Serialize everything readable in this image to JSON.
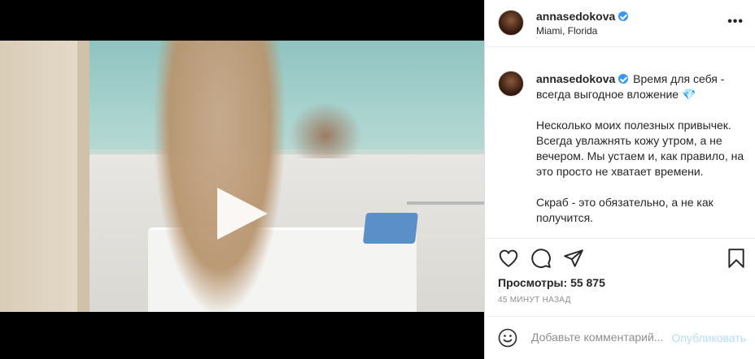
{
  "post": {
    "username": "annasedokova",
    "location": "Miami, Florida",
    "caption_title": "Время для себя - всегда выгодное вложение 💎",
    "caption_paragraphs": [
      "Несколько моих полезных привычек. Всегда увлажнять кожу утром, а не вечером. Мы устаем и, как правило, на это просто не хватает времени.",
      "Скраб - это обязательно, а не как получится."
    ],
    "views_label": "Просмотры:",
    "views_count": "55 875",
    "timestamp": "45 МИНУТ НАЗАД"
  },
  "comment": {
    "placeholder": "Добавьте комментарий...",
    "post_label": "Опубликовать"
  },
  "colors": {
    "verified": "#3897f0",
    "post_button": "#b2dffc",
    "text": "#262626",
    "muted": "#8e8e8e"
  },
  "icons": [
    "user-icon",
    "sound-icon",
    "play-icon",
    "more-icon",
    "heart-icon",
    "comment-icon",
    "share-icon",
    "bookmark-icon",
    "emoji-icon",
    "verified-badge-icon"
  ]
}
